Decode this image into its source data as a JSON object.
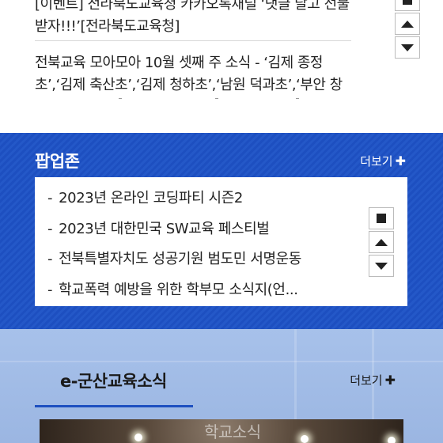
{
  "news": {
    "items": [
      "[이벤트] 전라북도교육청 카카오톡채널 ‘댓글 달고 선물 받자!!!’[전라북도교육청]",
      "전북교육 모아모아 10월 셋째 주 소식 - ‘김제 종정초’,‘김제 축산초’,‘김제 청하초’,‘남원 덕과초’,‘부안 창"
    ]
  },
  "popup_zone": {
    "title": "팝업존",
    "more_label": "더보기",
    "items": [
      "2023년 온라인 코딩파티 시즌2",
      "2023년 대한민국 SW교육 페스티벌",
      "전북특별자치도 성공기원 범도민 서명운동",
      "학교폭력 예방을 위한 학부모 소식지(언..."
    ],
    "bullet": "-"
  },
  "gunsan_news": {
    "title": "e-군산교육소식",
    "more_label": "더보기",
    "photo_caption": "학교소식"
  },
  "colors": {
    "popup_bg": "#1d4fc0",
    "gunsan_bg": "#a7c1ea",
    "accent_underline": "#1d4fc0"
  }
}
